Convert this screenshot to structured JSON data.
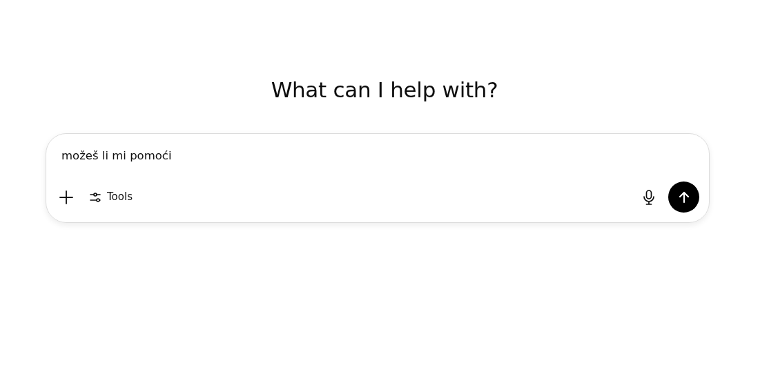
{
  "heading": "What can I help with?",
  "composer": {
    "value": "možeš li mi pomoći",
    "tools_label": "Tools"
  }
}
